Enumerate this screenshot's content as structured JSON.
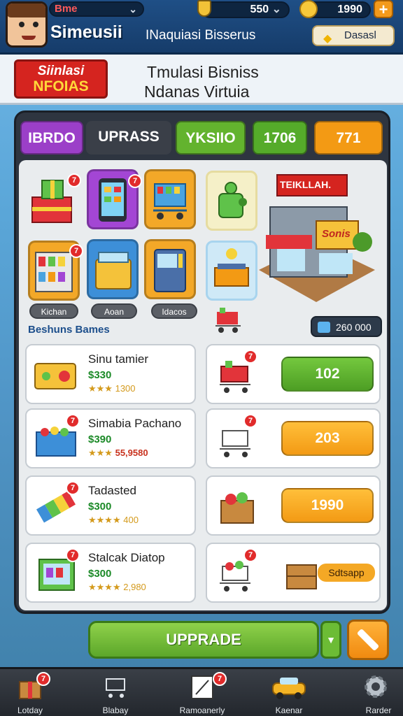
{
  "header": {
    "player_name": "Bme",
    "app_title": "Simeusii",
    "subtitle": "INaquiasi Bisserus",
    "level_value": "550",
    "coins_value": "1990",
    "plus_label": "+",
    "bonus_label": "Dasasl"
  },
  "banner": {
    "logo_line1": "Siinlasi",
    "logo_line2": "NFOIAS",
    "line1": "Tmulasi Bisniss",
    "line2": "Ndanas Virtuia"
  },
  "tabs": [
    {
      "label": "IBRDO",
      "color": "#9b3fc8"
    },
    {
      "label": "UPRASS",
      "color": "#3a3f48"
    },
    {
      "label": "YKSIIO",
      "color": "#63b32e"
    },
    {
      "label": "1706",
      "color": "#55ab2a"
    },
    {
      "label": "771",
      "color": "#f39a14"
    }
  ],
  "tile_labels": [
    "Kichan",
    "Aoan",
    "Idacos"
  ],
  "tile_badges": [
    "7",
    "7",
    "7"
  ],
  "store_sign": "TEIKLLAH.",
  "store_logo": "Sonis",
  "section_title": "Beshuns Bames",
  "total_value": "260 000",
  "items": [
    {
      "title": "Sinu tamier",
      "price": "$330",
      "stars": "★★★",
      "rating": "1300",
      "rating_alt": false,
      "action": "102",
      "action_color": "green"
    },
    {
      "title": "Simabia Pachano",
      "price": "$390",
      "stars": "★★★",
      "rating": "55,9580",
      "rating_alt": true,
      "action": "203",
      "action_color": "orange"
    },
    {
      "title": "Tadasted",
      "price": "$300",
      "stars": "★★★★",
      "rating": "400",
      "rating_alt": false,
      "action": "1990",
      "action_color": "orange"
    },
    {
      "title": "Stalcak Diatop",
      "price": "$300",
      "stars": "★★★★",
      "rating": "2,980",
      "rating_alt": false,
      "action": "Sdtsapp",
      "action_color": "crate"
    }
  ],
  "upgrade_label": "UPPRADE",
  "nav": [
    {
      "label": "Lotday",
      "badge": "7"
    },
    {
      "label": "Blabay",
      "badge": ""
    },
    {
      "label": "Ramoanerly",
      "badge": "7"
    },
    {
      "label": "Kaenar",
      "badge": ""
    },
    {
      "label": "Rarder",
      "badge": ""
    }
  ]
}
